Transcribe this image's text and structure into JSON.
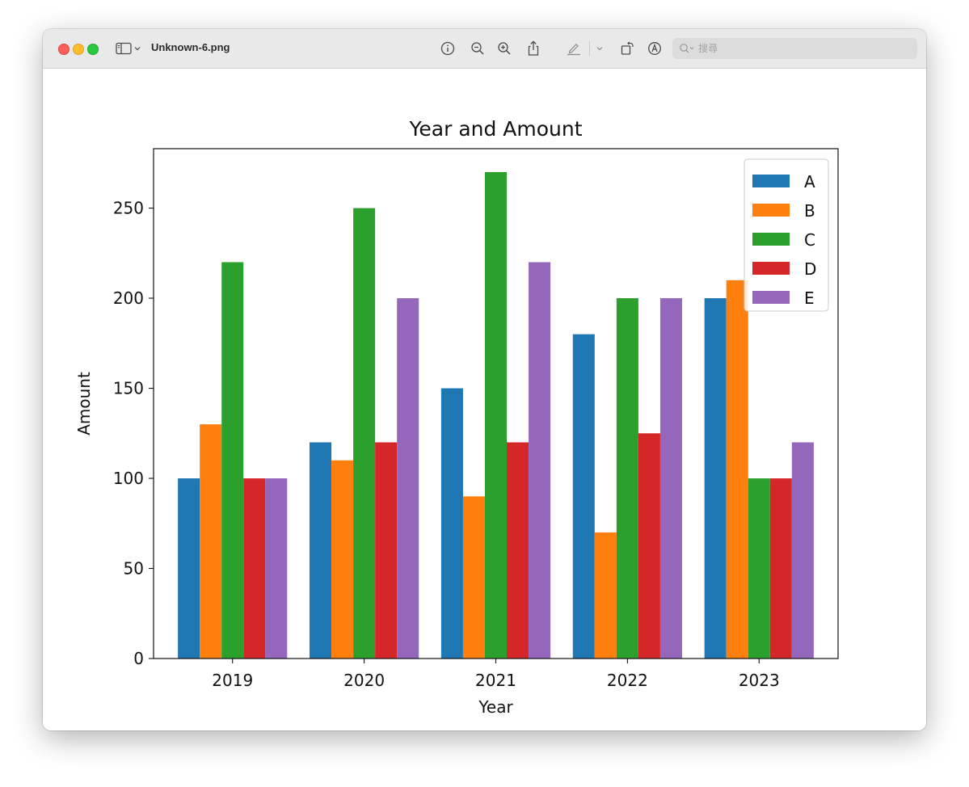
{
  "window": {
    "filename": "Unknown-6.png",
    "search": {
      "placeholder": "搜尋",
      "value": ""
    }
  },
  "icons": {
    "sidebar_toggle": "sidebar-icon",
    "info": "info-icon",
    "zoom_out": "zoom-out-icon",
    "zoom_in": "zoom-in-icon",
    "share": "share-icon",
    "markup": "pen-icon",
    "rotate": "rotate-icon",
    "annotate": "markup-circle-icon",
    "search": "search-icon"
  },
  "chart_data": {
    "type": "bar",
    "title": "Year and Amount",
    "xlabel": "Year",
    "ylabel": "Amount",
    "categories": [
      "2019",
      "2020",
      "2021",
      "2022",
      "2023"
    ],
    "ylim": [
      0,
      283
    ],
    "yticks": [
      0,
      50,
      100,
      150,
      200,
      250
    ],
    "grid": false,
    "legend_position": "top-right",
    "series": [
      {
        "name": "A",
        "color": "#1f77b4",
        "values": [
          100,
          120,
          150,
          180,
          200
        ]
      },
      {
        "name": "B",
        "color": "#ff7f0e",
        "values": [
          130,
          110,
          90,
          70,
          210
        ]
      },
      {
        "name": "C",
        "color": "#2ca02c",
        "values": [
          220,
          250,
          270,
          200,
          100
        ]
      },
      {
        "name": "D",
        "color": "#d62728",
        "values": [
          100,
          120,
          120,
          125,
          100
        ]
      },
      {
        "name": "E",
        "color": "#9467bd",
        "values": [
          100,
          200,
          220,
          200,
          120
        ]
      }
    ]
  }
}
